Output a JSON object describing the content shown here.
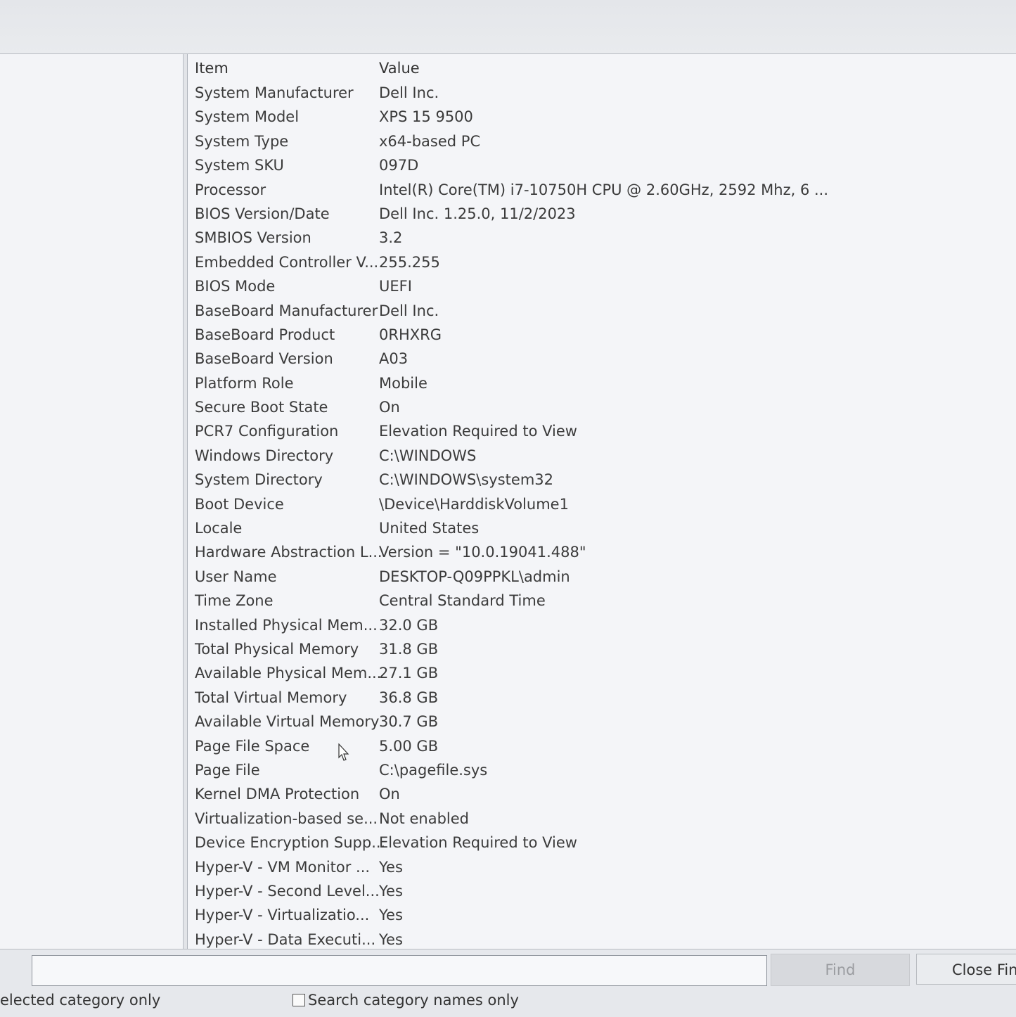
{
  "list": {
    "header": {
      "item": "Item",
      "value": "Value"
    },
    "rows": [
      {
        "item": "System Manufacturer",
        "value": "Dell Inc."
      },
      {
        "item": "System Model",
        "value": "XPS 15 9500"
      },
      {
        "item": "System Type",
        "value": "x64-based PC"
      },
      {
        "item": "System SKU",
        "value": "097D"
      },
      {
        "item": "Processor",
        "value": "Intel(R) Core(TM) i7-10750H CPU @ 2.60GHz, 2592 Mhz, 6 ..."
      },
      {
        "item": "BIOS Version/Date",
        "value": "Dell Inc. 1.25.0, 11/2/2023"
      },
      {
        "item": "SMBIOS Version",
        "value": "3.2"
      },
      {
        "item": "Embedded Controller V...",
        "value": "255.255"
      },
      {
        "item": "BIOS Mode",
        "value": "UEFI"
      },
      {
        "item": "BaseBoard Manufacturer",
        "value": "Dell Inc."
      },
      {
        "item": "BaseBoard Product",
        "value": "0RHXRG"
      },
      {
        "item": "BaseBoard Version",
        "value": "A03"
      },
      {
        "item": "Platform Role",
        "value": "Mobile"
      },
      {
        "item": "Secure Boot State",
        "value": "On"
      },
      {
        "item": "PCR7 Configuration",
        "value": "Elevation Required to View"
      },
      {
        "item": "Windows Directory",
        "value": "C:\\WINDOWS"
      },
      {
        "item": "System Directory",
        "value": "C:\\WINDOWS\\system32"
      },
      {
        "item": "Boot Device",
        "value": "\\Device\\HarddiskVolume1"
      },
      {
        "item": "Locale",
        "value": "United States"
      },
      {
        "item": "Hardware Abstraction L...",
        "value": "Version = \"10.0.19041.488\""
      },
      {
        "item": "User Name",
        "value": "DESKTOP-Q09PPKL\\admin"
      },
      {
        "item": "Time Zone",
        "value": "Central Standard Time"
      },
      {
        "item": "Installed Physical Mem...",
        "value": "32.0 GB"
      },
      {
        "item": "Total Physical Memory",
        "value": "31.8 GB"
      },
      {
        "item": "Available Physical Mem...",
        "value": "27.1 GB"
      },
      {
        "item": "Total Virtual Memory",
        "value": "36.8 GB"
      },
      {
        "item": "Available Virtual Memory",
        "value": "30.7 GB"
      },
      {
        "item": "Page File Space",
        "value": "5.00 GB"
      },
      {
        "item": "Page File",
        "value": "C:\\pagefile.sys"
      },
      {
        "item": "Kernel DMA Protection",
        "value": "On"
      },
      {
        "item": "Virtualization-based se...",
        "value": "Not enabled"
      },
      {
        "item": "Device Encryption Supp...",
        "value": "Elevation Required to View"
      },
      {
        "item": "Hyper-V - VM Monitor ...",
        "value": "Yes"
      },
      {
        "item": "Hyper-V - Second Level...",
        "value": "Yes"
      },
      {
        "item": "Hyper-V - Virtualizatio...",
        "value": "Yes"
      },
      {
        "item": "Hyper-V - Data Executi...",
        "value": "Yes"
      }
    ]
  },
  "find": {
    "input_value": "",
    "find_label": "Find",
    "close_label": "Close Find",
    "search_selected_label": "elected category only",
    "search_names_label": "Search category names only"
  },
  "icons": {
    "cursor": "mouse-pointer-icon"
  }
}
